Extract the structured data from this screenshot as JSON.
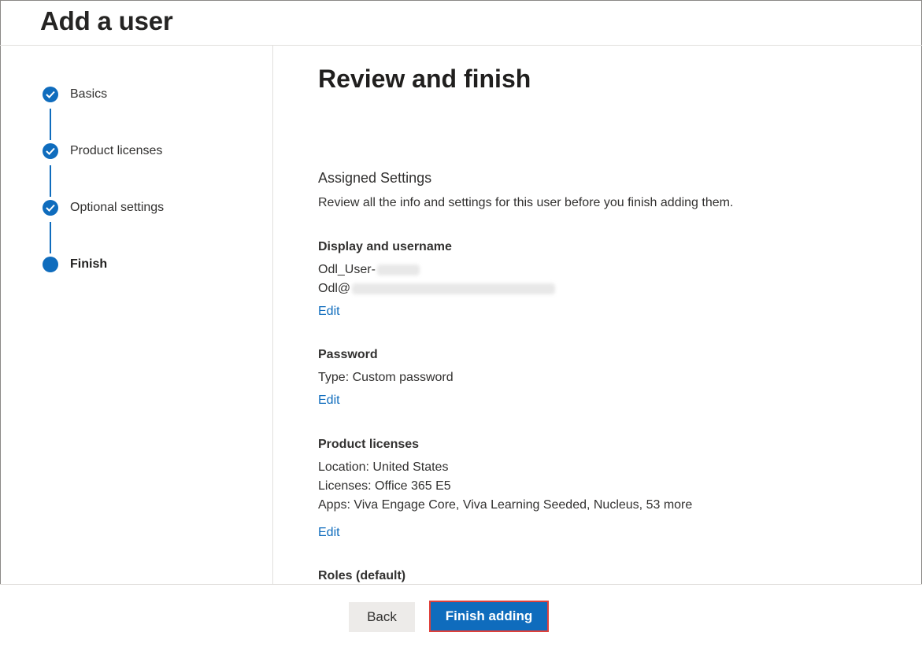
{
  "header": {
    "title": "Add a user"
  },
  "steps": [
    {
      "label": "Basics",
      "state": "complete"
    },
    {
      "label": "Product licenses",
      "state": "complete"
    },
    {
      "label": "Optional settings",
      "state": "complete"
    },
    {
      "label": "Finish",
      "state": "current"
    }
  ],
  "main": {
    "title": "Review and finish",
    "assigned": {
      "heading": "Assigned Settings",
      "description": "Review all the info and settings for this user before you finish adding them."
    },
    "display": {
      "heading": "Display and username",
      "display_name_prefix": "Odl_User-",
      "username_prefix": "Odl@",
      "edit_label": "Edit"
    },
    "password": {
      "heading": "Password",
      "type_text": "Type: Custom password",
      "edit_label": "Edit"
    },
    "licenses": {
      "heading": "Product licenses",
      "location": "Location: United States",
      "licenses": "Licenses: Office 365 E5",
      "apps": "Apps: Viva Engage Core, Viva Learning Seeded, Nucleus, 53 more",
      "edit_label": "Edit"
    },
    "roles": {
      "heading": "Roles (default)"
    }
  },
  "footer": {
    "back_label": "Back",
    "finish_label": "Finish adding"
  },
  "colors": {
    "accent": "#0f6cbd",
    "highlight_border": "#e0403a"
  }
}
